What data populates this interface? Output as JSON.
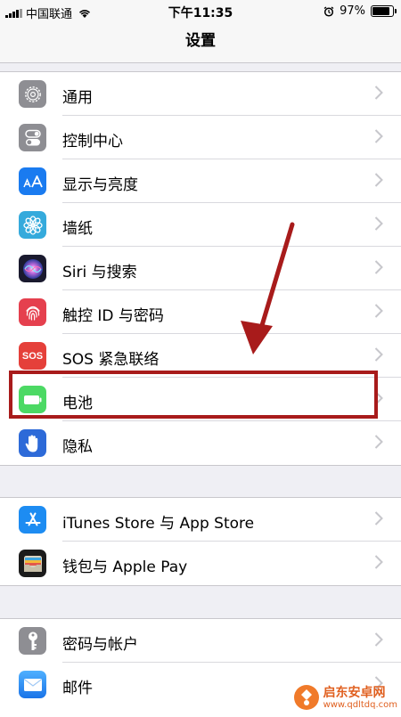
{
  "status": {
    "carrier": "中国联通",
    "time": "下午11:35",
    "battery": "97%",
    "battery_level": 0.97
  },
  "nav": {
    "title": "设置"
  },
  "group1": [
    {
      "label": "通用",
      "icon": "gear-icon",
      "color": "#8e8e93"
    },
    {
      "label": "控制中心",
      "icon": "toggles-icon",
      "color": "#8e8e93"
    },
    {
      "label": "显示与亮度",
      "icon": "text-size-icon",
      "color": "#1a7bf0"
    },
    {
      "label": "墙纸",
      "icon": "flower-icon",
      "color": "#35aadc"
    },
    {
      "label": "Siri 与搜索",
      "icon": "siri-icon",
      "color": "#1a1a2e"
    },
    {
      "label": "触控 ID 与密码",
      "icon": "fingerprint-icon",
      "color": "#e5404e"
    },
    {
      "label": "SOS 紧急联络",
      "icon": "sos-icon",
      "color": "#e5403a"
    },
    {
      "label": "电池",
      "icon": "battery-icon",
      "color": "#4cd964"
    },
    {
      "label": "隐私",
      "icon": "hand-icon",
      "color": "#2d6ad8"
    }
  ],
  "group2": [
    {
      "label": "iTunes Store 与 App Store",
      "icon": "app-store-icon",
      "color": "#1d8cf2"
    },
    {
      "label": "钱包与 Apple Pay",
      "icon": "wallet-icon",
      "color": "#1b1b1b"
    }
  ],
  "group3": [
    {
      "label": "密码与帐户",
      "icon": "key-icon",
      "color": "#8e8e93"
    },
    {
      "label": "邮件",
      "icon": "mail-icon",
      "color": "#2f86f0"
    }
  ],
  "sos_text": "SOS",
  "watermark": {
    "text": "启东安卓网",
    "url": "www.qdltdq.com"
  }
}
